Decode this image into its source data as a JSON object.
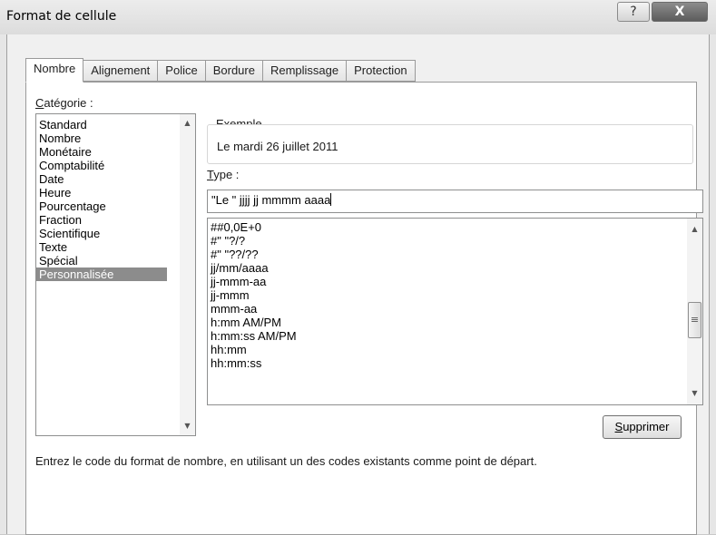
{
  "window": {
    "title": "Format de cellule",
    "help_label": "?",
    "close_label": "X"
  },
  "tabs": [
    {
      "label": "Nombre",
      "active": true
    },
    {
      "label": "Alignement",
      "active": false
    },
    {
      "label": "Police",
      "active": false
    },
    {
      "label": "Bordure",
      "active": false
    },
    {
      "label": "Remplissage",
      "active": false
    },
    {
      "label": "Protection",
      "active": false
    }
  ],
  "category": {
    "label_first": "C",
    "label_rest": "atégorie :",
    "items": [
      "Standard",
      "Nombre",
      "Monétaire",
      "Comptabilité",
      "Date",
      "Heure",
      "Pourcentage",
      "Fraction",
      "Scientifique",
      "Texte",
      "Spécial",
      "Personnalisée"
    ],
    "selected": "Personnalisée"
  },
  "sample": {
    "legend": "Exemple",
    "value": "Le  mardi 26 juillet 2011"
  },
  "type": {
    "label_first": "T",
    "label_rest": "ype :",
    "value": "\"Le \" jjjj jj mmmm aaaa",
    "options": [
      "##0,0E+0",
      "#\" \"?/?",
      "#\" \"??/??",
      "jj/mm/aaaa",
      "jj-mmm-aa",
      "jj-mmm",
      "mmm-aa",
      "h:mm AM/PM",
      "h:mm:ss AM/PM",
      "hh:mm",
      "hh:mm:ss"
    ],
    "scroll_thumb_glyph": "≡"
  },
  "delete_button": {
    "label_first": "S",
    "label_rest": "upprimer"
  },
  "help_text": "Entrez le code du format de nombre, en utilisant un des codes existants comme point de départ.",
  "colors": {
    "selection": "#8c8c8c",
    "panel": "#ffffff",
    "titlebar": "#e6e6e6"
  }
}
